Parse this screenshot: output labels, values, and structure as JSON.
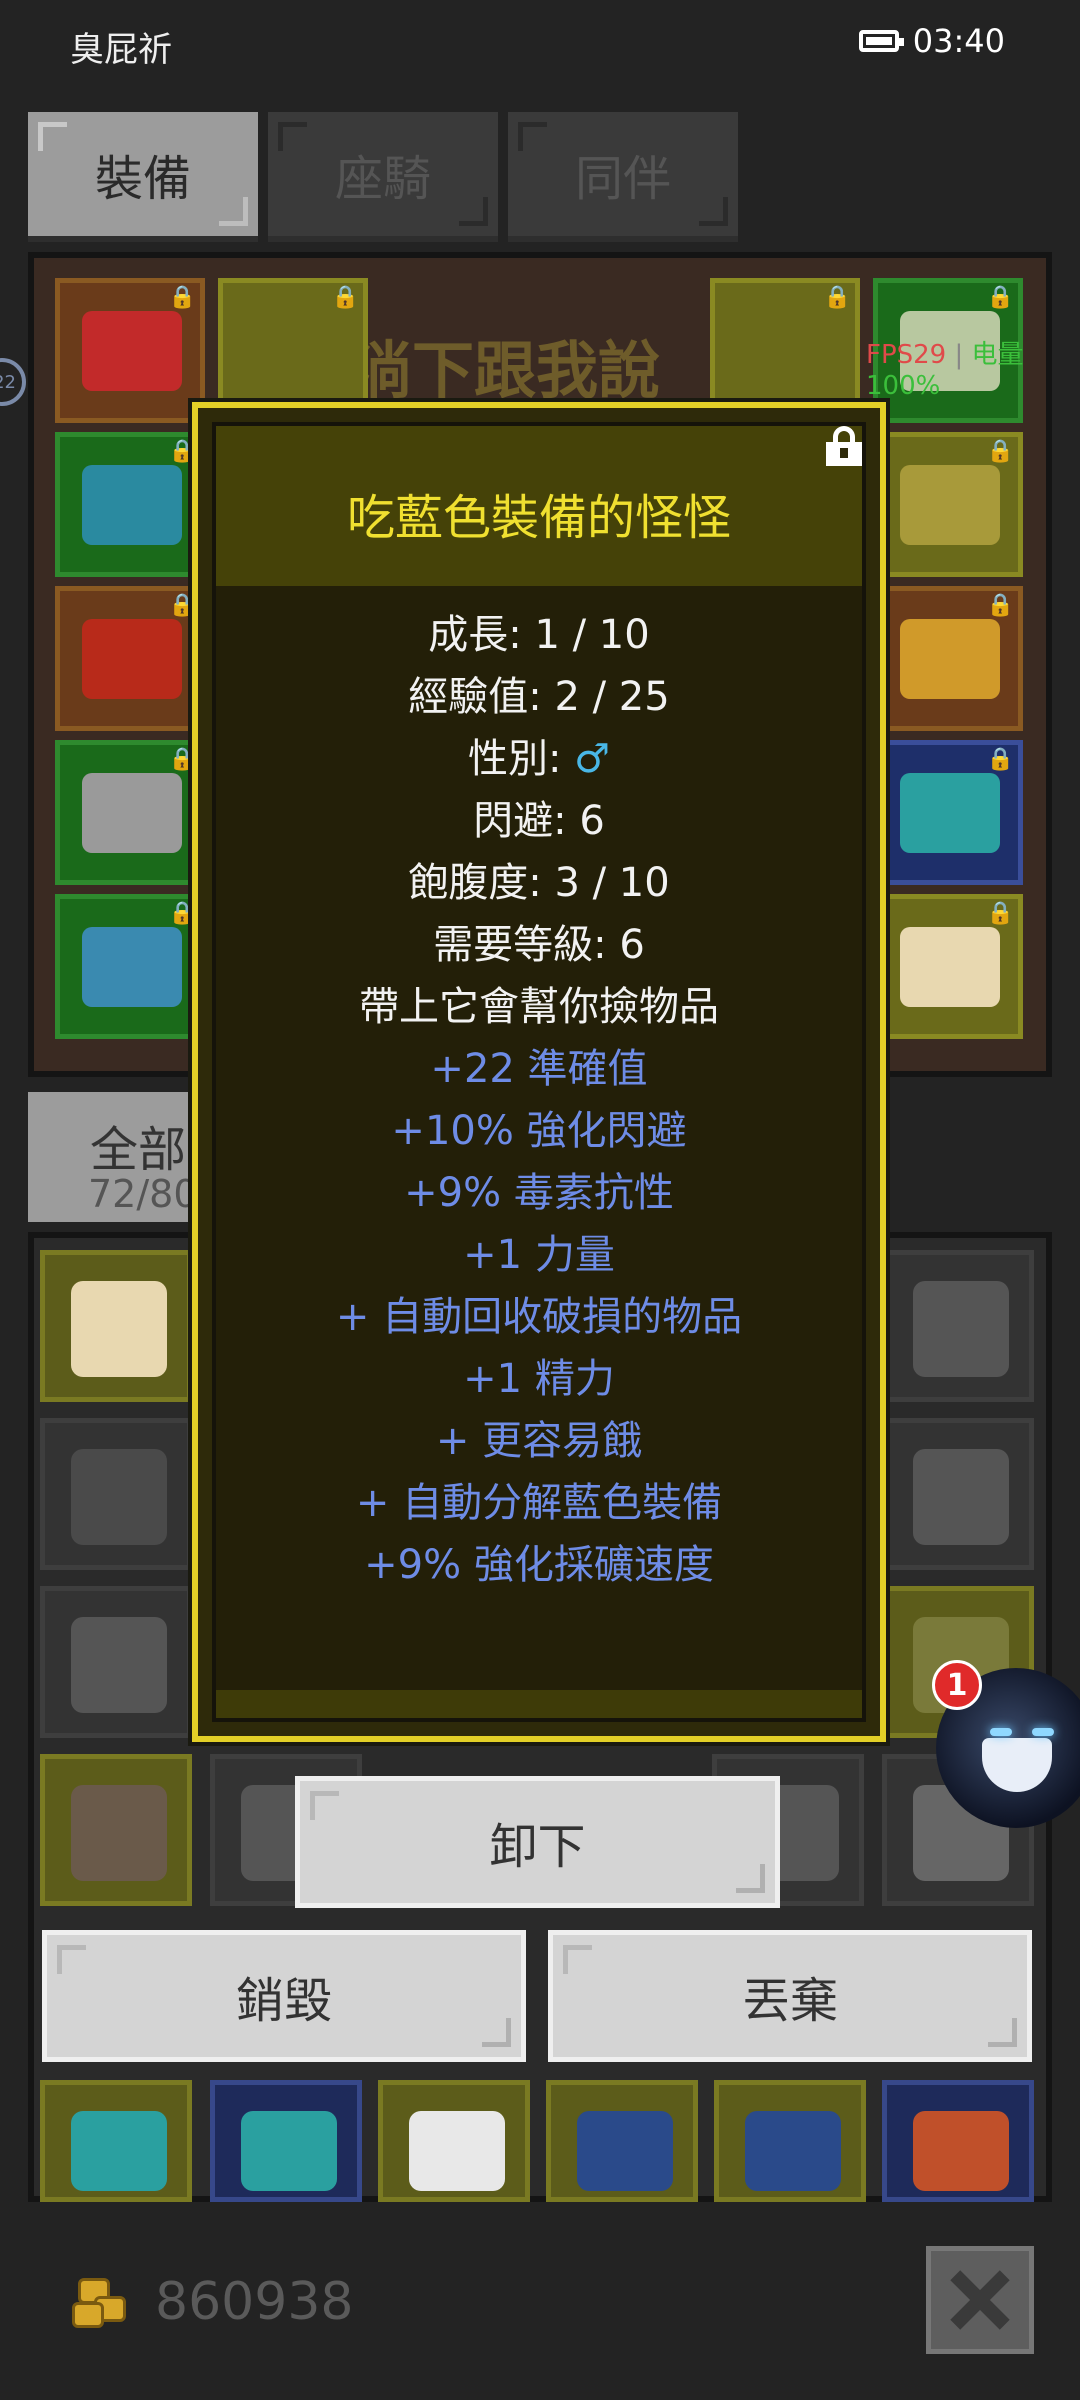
{
  "status_bar": {
    "carrier": "臭屁祈",
    "time": "03:40"
  },
  "tabs": [
    {
      "label": "裝備",
      "active": true
    },
    {
      "label": "座騎",
      "active": false
    },
    {
      "label": "同伴",
      "active": false
    }
  ],
  "equipment_banner": "淌下跟我說",
  "overlay": {
    "fps": "FPS29",
    "battery": "电量100%",
    "side_badge": "22"
  },
  "inventory_filter": {
    "label": "全部",
    "count": "72/80"
  },
  "item_popup": {
    "title": "吃藍色裝備的怪怪",
    "stats": [
      "成長: 1 / 10",
      "經驗值: 2 / 25",
      "性別: ♂",
      "閃避: 6",
      "飽腹度: 3 / 10",
      "需要等級: 6",
      "帶上它會幫你撿物品"
    ],
    "bonuses": [
      "+22 準確值",
      "+10% 強化閃避",
      "+9% 毒素抗性",
      "+1 力量",
      "+ 自動回收破損的物品",
      "+1 精力",
      "+ 更容易餓",
      "+ 自動分解藍色裝備",
      "+9% 強化採礦速度"
    ]
  },
  "actions": {
    "unequip": "卸下",
    "destroy": "銷毀",
    "drop": "丟棄"
  },
  "notification": {
    "count": "1"
  },
  "gold": {
    "amount": "860938"
  },
  "colors": {
    "modal_border": "#e3d027",
    "title": "#f0e030",
    "bonus_text": "#6e8ce6",
    "male_symbol": "#49b7e6"
  }
}
